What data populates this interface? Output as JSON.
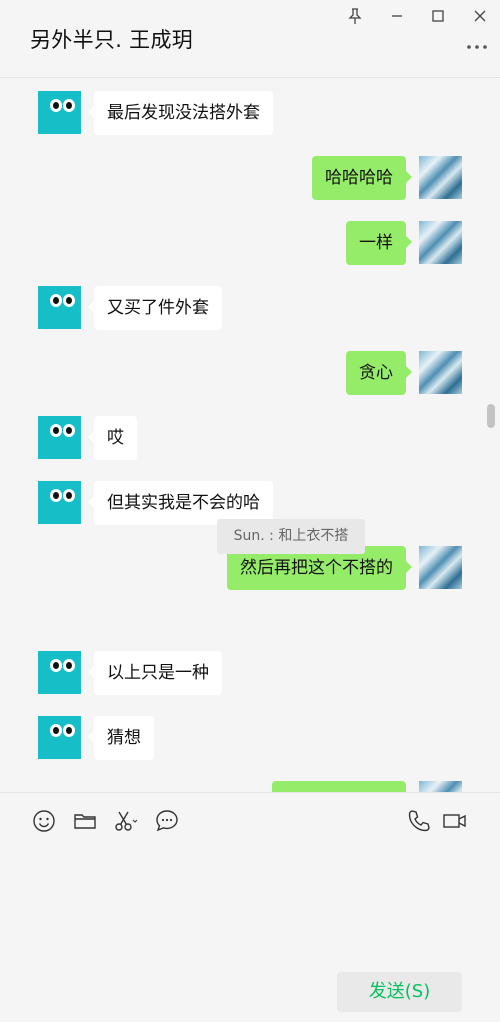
{
  "window": {
    "title": "另外半只. 王成玥",
    "pin_icon": "pin-icon",
    "minimize_icon": "minimize-icon",
    "maximize_icon": "maximize-icon",
    "close_icon": "close-icon",
    "more_icon": "more-icon"
  },
  "messages": [
    {
      "side": "in",
      "text": "最后发现没法搭外套"
    },
    {
      "side": "out",
      "text": "哈哈哈哈"
    },
    {
      "side": "out",
      "text": "一样"
    },
    {
      "side": "in",
      "text": "又买了件外套"
    },
    {
      "side": "out",
      "text": "贪心"
    },
    {
      "side": "in",
      "text": "哎"
    },
    {
      "side": "in",
      "text": "但其实我是不会的哈"
    },
    {
      "side": "out",
      "text": "然后再把这个不搭的"
    },
    {
      "side": "in",
      "text": "以上只是一种"
    },
    {
      "side": "in",
      "text": "猜想"
    },
    {
      "side": "out",
      "text": ""
    }
  ],
  "quote": {
    "text": "Sun. : 和上衣不搭"
  },
  "toolbar": {
    "icons": [
      "emoji-icon",
      "folder-icon",
      "scissors-icon",
      "chat-history-icon",
      "phone-icon",
      "video-icon"
    ]
  },
  "input": {
    "value": ""
  },
  "send_button": {
    "label": "发送(S)"
  },
  "colors": {
    "outgoing_bubble": "#95ec69",
    "incoming_bubble": "#ffffff",
    "send_text": "#07c160",
    "avatar_bg": "#16bfc7"
  }
}
